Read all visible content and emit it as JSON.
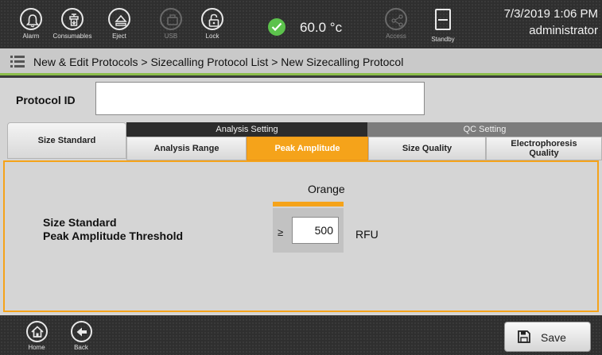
{
  "topbar": {
    "buttons": [
      {
        "id": "alarm",
        "label": "Alarm",
        "icon": "bell-icon"
      },
      {
        "id": "consumables",
        "label": "Consumables",
        "icon": "consumables-icon"
      },
      {
        "id": "eject",
        "label": "Eject",
        "icon": "eject-icon"
      },
      {
        "id": "usb",
        "label": "USB",
        "icon": "usb-icon",
        "disabled": true
      },
      {
        "id": "lock",
        "label": "Lock",
        "icon": "lock-icon"
      },
      {
        "id": "access",
        "label": "Access",
        "icon": "share-icon",
        "disabled": true
      },
      {
        "id": "standby",
        "label": "Standby",
        "icon": "standby-icon"
      }
    ],
    "status_icon": "check-icon",
    "status_color": "#5cc24c",
    "temperature": "60.0 °c",
    "datetime": "7/3/2019 1:06 PM",
    "user": "administrator"
  },
  "breadcrumb": {
    "icon": "menu-icon",
    "text": "New & Edit Protocols > Sizecalling Protocol List > New Sizecalling Protocol",
    "accent_color": "#8cbd4a"
  },
  "protocol": {
    "label": "Protocol ID",
    "value": ""
  },
  "tabs": {
    "size_standard": "Size Standard",
    "groups": {
      "analysis": "Analysis Setting",
      "qc": "QC Setting"
    },
    "analysis_range": "Analysis Range",
    "peak_amplitude": "Peak Amplitude",
    "size_quality": "Size Quality",
    "electrophoresis_line1": "Electrophoresis",
    "electrophoresis_line2": "Quality",
    "active": "peak_amplitude",
    "active_color": "#f5a31a"
  },
  "peak_amplitude": {
    "dye": "Orange",
    "dye_color": "#f5a31a",
    "label_line1": "Size Standard",
    "label_line2": "Peak Amplitude Threshold",
    "operator": "≥",
    "value": "500",
    "unit": "RFU"
  },
  "bottombar": {
    "home": "Home",
    "back": "Back",
    "save": "Save",
    "save_icon": "save-icon"
  }
}
